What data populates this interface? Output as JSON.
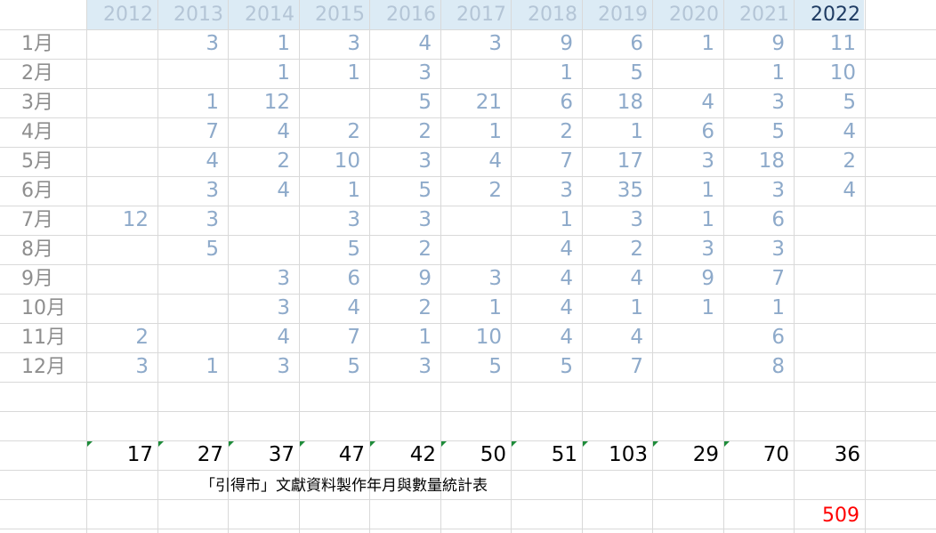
{
  "years": [
    "2012",
    "2013",
    "2014",
    "2015",
    "2016",
    "2017",
    "2018",
    "2019",
    "2020",
    "2021",
    "2022"
  ],
  "months": [
    "1月",
    "2月",
    "3月",
    "4月",
    "5月",
    "6月",
    "7月",
    "8月",
    "9月",
    "10月",
    "11月",
    "12月"
  ],
  "values": [
    [
      "",
      "3",
      "1",
      "3",
      "4",
      "3",
      "9",
      "6",
      "1",
      "9",
      "11"
    ],
    [
      "",
      "",
      "1",
      "1",
      "3",
      "",
      "1",
      "5",
      "",
      "1",
      "10"
    ],
    [
      "",
      "1",
      "12",
      "",
      "5",
      "21",
      "6",
      "18",
      "4",
      "3",
      "5"
    ],
    [
      "",
      "7",
      "4",
      "2",
      "2",
      "1",
      "2",
      "1",
      "6",
      "5",
      "4"
    ],
    [
      "",
      "4",
      "2",
      "10",
      "3",
      "4",
      "7",
      "17",
      "3",
      "18",
      "2"
    ],
    [
      "",
      "3",
      "4",
      "1",
      "5",
      "2",
      "3",
      "35",
      "1",
      "3",
      "4"
    ],
    [
      "12",
      "3",
      "",
      "3",
      "3",
      "",
      "1",
      "3",
      "1",
      "6",
      ""
    ],
    [
      "",
      "5",
      "",
      "5",
      "2",
      "",
      "4",
      "2",
      "3",
      "3",
      ""
    ],
    [
      "",
      "",
      "3",
      "6",
      "9",
      "3",
      "4",
      "4",
      "9",
      "7",
      ""
    ],
    [
      "",
      "",
      "3",
      "4",
      "2",
      "1",
      "4",
      "1",
      "1",
      "1",
      ""
    ],
    [
      "2",
      "",
      "4",
      "7",
      "1",
      "10",
      "4",
      "4",
      "",
      "6",
      ""
    ],
    [
      "3",
      "1",
      "3",
      "5",
      "3",
      "5",
      "5",
      "7",
      "",
      "8",
      ""
    ]
  ],
  "totals": [
    "17",
    "27",
    "37",
    "47",
    "42",
    "50",
    "51",
    "103",
    "29",
    "70",
    "36"
  ],
  "caption": "「引得市」文獻資料製作年月與數量統計表",
  "grand_total": "509",
  "colors": {
    "header_bg": "#dcebf5",
    "year_text": "#b4c5d6",
    "year_current": "#1f3c63",
    "value_text": "#8eaaca",
    "month_text": "#8e8e8e",
    "grid": "#d9d9d9",
    "grand_total_text": "#ff0000",
    "error_marker": "#1e8c3a"
  }
}
